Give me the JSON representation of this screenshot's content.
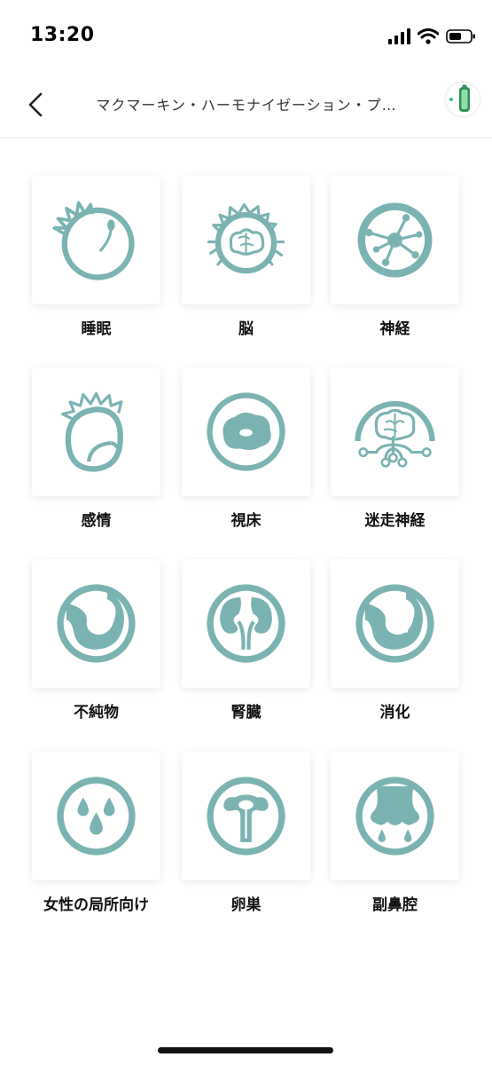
{
  "status_bar": {
    "time": "13:20"
  },
  "nav": {
    "title": "マクマーキン・ハーモナイゼーション・プ…"
  },
  "theme": {
    "accent": "#7AB3B1",
    "accent_light": "#A9D0CE"
  },
  "programs": [
    {
      "label": "睡眠",
      "icon": "sleep-icon"
    },
    {
      "label": "脳",
      "icon": "brain-icon"
    },
    {
      "label": "神経",
      "icon": "nerve-icon"
    },
    {
      "label": "感情",
      "icon": "emotion-icon"
    },
    {
      "label": "視床",
      "icon": "thalamus-icon"
    },
    {
      "label": "迷走神経",
      "icon": "vagus-nerve-icon"
    },
    {
      "label": "不純物",
      "icon": "impurities-icon"
    },
    {
      "label": "腎臓",
      "icon": "kidney-icon"
    },
    {
      "label": "消化",
      "icon": "digestion-icon"
    },
    {
      "label": "女性の局所向け",
      "icon": "feminine-care-icon"
    },
    {
      "label": "卵巣",
      "icon": "ovary-icon"
    },
    {
      "label": "副鼻腔",
      "icon": "sinus-icon"
    }
  ]
}
